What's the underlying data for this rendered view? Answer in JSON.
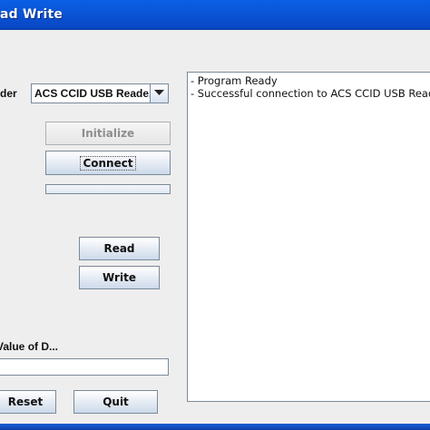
{
  "window": {
    "title": "ad Write"
  },
  "reader": {
    "label": "der",
    "selected": "ACS CCID USB Reade..."
  },
  "buttons": {
    "initialize": "Initialize",
    "connect": "Connect",
    "read": "Read",
    "write": "Write",
    "reset": "Reset",
    "quit": "Quit"
  },
  "data_field": {
    "label": "Value of D...",
    "value": ""
  },
  "log": {
    "lines": [
      "- Program Ready",
      "- Successful connection to ACS CCID USB Read"
    ]
  }
}
